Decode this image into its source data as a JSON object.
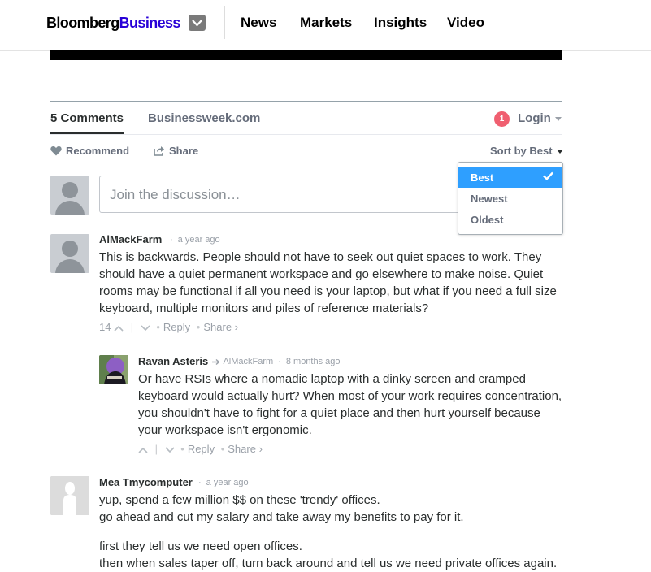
{
  "header": {
    "logo_prefix": "Bloomberg",
    "logo_suffix": "Business",
    "nav": [
      "News",
      "Markets",
      "Insights",
      "Video"
    ]
  },
  "disqus": {
    "comments_tab": "5 Comments",
    "site_tab": "Businessweek.com",
    "notification_count": "1",
    "login_label": "Login",
    "recommend_label": "Recommend",
    "share_label": "Share",
    "sort_label": "Sort by Best",
    "sort_options": [
      "Best",
      "Newest",
      "Oldest"
    ],
    "selected_sort": "Best",
    "join_placeholder": "Join the discussion…"
  },
  "comments": [
    {
      "author": "AlMackFarm",
      "time": "a year ago",
      "lines": [
        "This is backwards. People should not have to seek out quiet spaces to work. They",
        "should have a quiet permanent workspace and go elsewhere to make noise. Quiet",
        "rooms may be functional if all you need is your laptop, but what if you need a full size",
        "keyboard, multiple monitors and piles of reference materials?"
      ],
      "votes": "14",
      "reply": "Reply",
      "share": "Share ›"
    },
    {
      "author": "Ravan Asteris",
      "reply_to": "AlMackFarm",
      "time": "8 months ago",
      "lines": [
        "Or have RSIs where a nomadic laptop with a dinky screen and cramped",
        "keyboard would actually hurt? When most of your work requires concentration,",
        "you shouldn't have to fight for a quiet place and then hurt yourself because",
        "your workspace isn't ergonomic."
      ],
      "reply": "Reply",
      "share": "Share ›"
    },
    {
      "author": "Mea Tmycomputer",
      "time": "a year ago",
      "lines": [
        "yup, spend a few million $$ on these 'trendy' offices.",
        "go ahead and cut my salary and take away my benefits to pay for it.",
        "first they tell us we need open offices.",
        "then when sales taper off, turn back around and tell us we need private offices again."
      ]
    }
  ],
  "colors": {
    "brand": "#2800d7",
    "accent_blue": "#2e9fff",
    "notification": "#f05f70",
    "text": "#2a2e2e",
    "muted": "#656c7a"
  }
}
